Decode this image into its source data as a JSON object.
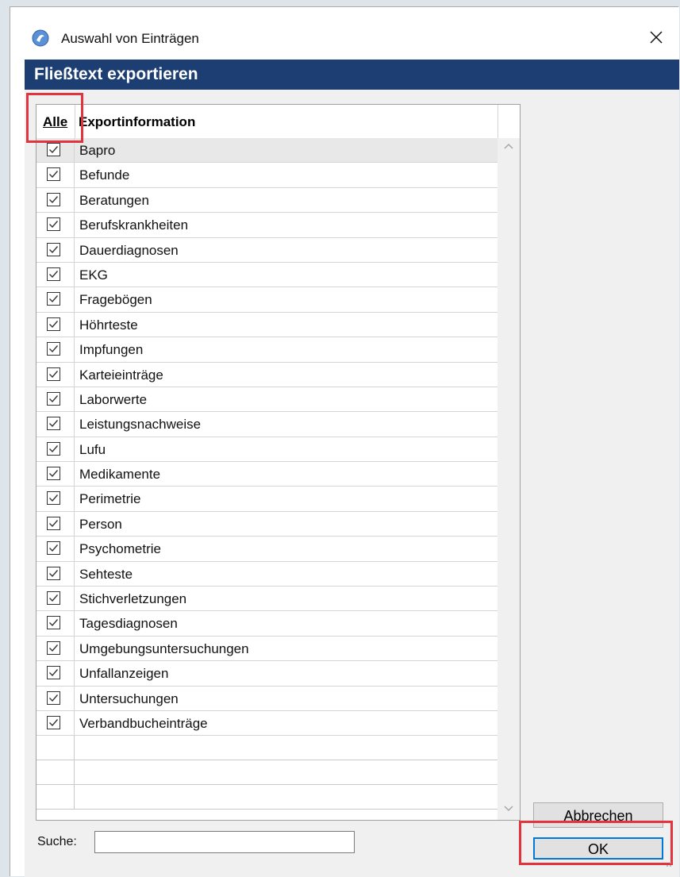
{
  "window": {
    "title": "Auswahl von Einträgen",
    "section_title": "Fließtext exportieren"
  },
  "grid": {
    "select_all_label": "Alle",
    "column_header": "Exportinformation",
    "items": [
      {
        "label": "Bapro",
        "checked": true
      },
      {
        "label": "Befunde",
        "checked": true
      },
      {
        "label": "Beratungen",
        "checked": true
      },
      {
        "label": "Berufskrankheiten",
        "checked": true
      },
      {
        "label": "Dauerdiagnosen",
        "checked": true
      },
      {
        "label": "EKG",
        "checked": true
      },
      {
        "label": "Fragebögen",
        "checked": true
      },
      {
        "label": "Höhrteste",
        "checked": true
      },
      {
        "label": "Impfungen",
        "checked": true
      },
      {
        "label": "Karteieinträge",
        "checked": true
      },
      {
        "label": "Laborwerte",
        "checked": true
      },
      {
        "label": "Leistungsnachweise",
        "checked": true
      },
      {
        "label": "Lufu",
        "checked": true
      },
      {
        "label": "Medikamente",
        "checked": true
      },
      {
        "label": "Perimetrie",
        "checked": true
      },
      {
        "label": "Person",
        "checked": true
      },
      {
        "label": "Psychometrie",
        "checked": true
      },
      {
        "label": "Sehteste",
        "checked": true
      },
      {
        "label": "Stichverletzungen",
        "checked": true
      },
      {
        "label": "Tagesdiagnosen",
        "checked": true
      },
      {
        "label": "Umgebungsuntersuchungen",
        "checked": true
      },
      {
        "label": "Unfallanzeigen",
        "checked": true
      },
      {
        "label": "Untersuchungen",
        "checked": true
      },
      {
        "label": "Verbandbucheinträge",
        "checked": true
      }
    ]
  },
  "search": {
    "label": "Suche:",
    "value": ""
  },
  "buttons": {
    "cancel": "Abbrechen",
    "ok": "OK"
  },
  "colors": {
    "header_band": "#1d3e73",
    "highlight": "#e2343e",
    "focus_border": "#0078d7"
  }
}
